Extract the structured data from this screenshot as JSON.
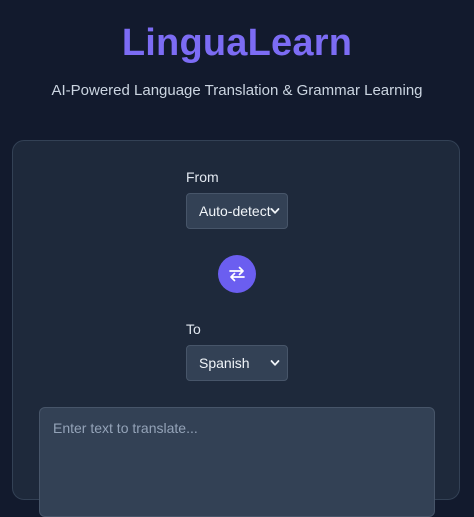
{
  "header": {
    "title": "LinguaLearn",
    "subtitle": "AI-Powered Language Translation & Grammar Learning"
  },
  "translator": {
    "from_label": "From",
    "from_value": "Auto-detect",
    "to_label": "To",
    "to_value": "Spanish",
    "swap_icon": "swap-arrows-icon",
    "input_placeholder": "Enter text to translate..."
  },
  "colors": {
    "background": "#121a2d",
    "card": "#1e293b",
    "accent": "#6b5ef0",
    "title": "#7c6cf4"
  }
}
